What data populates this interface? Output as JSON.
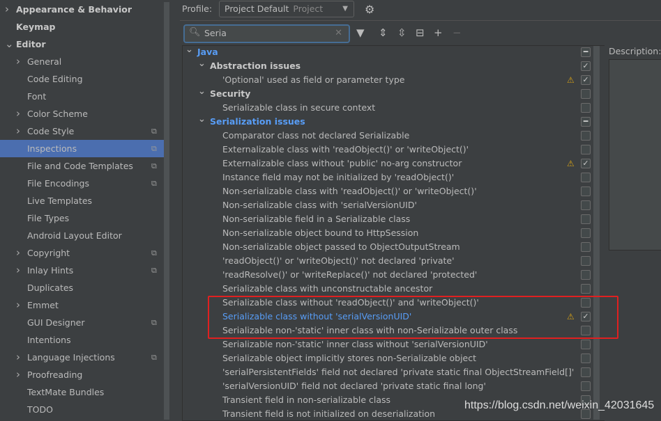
{
  "sidebar": {
    "items": [
      {
        "label": "Appearance & Behavior",
        "level": 0,
        "chevron": "right",
        "bold": true
      },
      {
        "label": "Keymap",
        "level": 0,
        "bold": true
      },
      {
        "label": "Editor",
        "level": 0,
        "chevron": "down",
        "bold": true
      },
      {
        "label": "General",
        "level": 1,
        "chevron": "right"
      },
      {
        "label": "Code Editing",
        "level": 1
      },
      {
        "label": "Font",
        "level": 1
      },
      {
        "label": "Color Scheme",
        "level": 1,
        "chevron": "right"
      },
      {
        "label": "Code Style",
        "level": 1,
        "chevron": "right",
        "copy": true
      },
      {
        "label": "Inspections",
        "level": 1,
        "copy": true,
        "selected": true
      },
      {
        "label": "File and Code Templates",
        "level": 1,
        "copy": true
      },
      {
        "label": "File Encodings",
        "level": 1,
        "copy": true
      },
      {
        "label": "Live Templates",
        "level": 1
      },
      {
        "label": "File Types",
        "level": 1
      },
      {
        "label": "Android Layout Editor",
        "level": 1
      },
      {
        "label": "Copyright",
        "level": 1,
        "chevron": "right",
        "copy": true
      },
      {
        "label": "Inlay Hints",
        "level": 1,
        "chevron": "right",
        "copy": true
      },
      {
        "label": "Duplicates",
        "level": 1
      },
      {
        "label": "Emmet",
        "level": 1,
        "chevron": "right"
      },
      {
        "label": "GUI Designer",
        "level": 1,
        "copy": true
      },
      {
        "label": "Intentions",
        "level": 1
      },
      {
        "label": "Language Injections",
        "level": 1,
        "chevron": "right",
        "copy": true
      },
      {
        "label": "Proofreading",
        "level": 1,
        "chevron": "right"
      },
      {
        "label": "TextMate Bundles",
        "level": 1
      },
      {
        "label": "TODO",
        "level": 1
      }
    ]
  },
  "profile": {
    "label": "Profile:",
    "value": "Project Default",
    "scope": "Project"
  },
  "search": {
    "value": "Seria"
  },
  "description": {
    "label": "Description:"
  },
  "tree": [
    {
      "label": "Java",
      "level": 0,
      "type": "java",
      "state": "partial"
    },
    {
      "label": "Abstraction issues",
      "level": 1,
      "type": "cat",
      "state": "checked"
    },
    {
      "label": "'Optional' used as field or parameter type",
      "level": 2,
      "state": "checked",
      "warning": true
    },
    {
      "label": "Security",
      "level": 1,
      "type": "cat",
      "state": "unchecked"
    },
    {
      "label": "Serializable class in secure context",
      "level": 2,
      "state": "unchecked"
    },
    {
      "label": "Serialization issues",
      "level": 1,
      "type": "java",
      "state": "partial"
    },
    {
      "label": "Comparator class not declared Serializable",
      "level": 2,
      "state": "unchecked"
    },
    {
      "label": "Externalizable class with 'readObject()' or 'writeObject()'",
      "level": 2,
      "state": "unchecked"
    },
    {
      "label": "Externalizable class without 'public' no-arg constructor",
      "level": 2,
      "state": "checked",
      "warning": true
    },
    {
      "label": "Instance field may not be initialized by 'readObject()'",
      "level": 2,
      "state": "unchecked"
    },
    {
      "label": "Non-serializable class with 'readObject()' or 'writeObject()'",
      "level": 2,
      "state": "unchecked"
    },
    {
      "label": "Non-serializable class with 'serialVersionUID'",
      "level": 2,
      "state": "unchecked"
    },
    {
      "label": "Non-serializable field in a Serializable class",
      "level": 2,
      "state": "unchecked"
    },
    {
      "label": "Non-serializable object bound to HttpSession",
      "level": 2,
      "state": "unchecked"
    },
    {
      "label": "Non-serializable object passed to ObjectOutputStream",
      "level": 2,
      "state": "unchecked"
    },
    {
      "label": "'readObject()' or 'writeObject()' not declared 'private'",
      "level": 2,
      "state": "unchecked"
    },
    {
      "label": "'readResolve()' or 'writeReplace()' not declared 'protected'",
      "level": 2,
      "state": "unchecked"
    },
    {
      "label": "Serializable class with unconstructable ancestor",
      "level": 2,
      "state": "unchecked"
    },
    {
      "label": "Serializable class without 'readObject()' and 'writeObject()'",
      "level": 2,
      "state": "unchecked"
    },
    {
      "label": "Serializable class without 'serialVersionUID'",
      "level": 2,
      "state": "checked",
      "warning": true,
      "highlight": true
    },
    {
      "label": "Serializable non-'static' inner class with non-Serializable outer class",
      "level": 2,
      "state": "unchecked"
    },
    {
      "label": "Serializable non-'static' inner class without 'serialVersionUID'",
      "level": 2,
      "state": "unchecked"
    },
    {
      "label": "Serializable object implicitly stores non-Serializable object",
      "level": 2,
      "state": "unchecked"
    },
    {
      "label": "'serialPersistentFields' field not declared 'private static final ObjectStreamField[]'",
      "level": 2,
      "state": "unchecked"
    },
    {
      "label": "'serialVersionUID' field not declared 'private static final long'",
      "level": 2,
      "state": "unchecked"
    },
    {
      "label": "Transient field in non-serializable class",
      "level": 2,
      "state": "unchecked"
    },
    {
      "label": "Transient field is not initialized on deserialization",
      "level": 2,
      "state": "unchecked"
    }
  ],
  "watermark": "https://blog.csdn.net/weixin_42031645",
  "colors": {
    "selection": "#4b6eaf",
    "link": "#589df6",
    "warning": "#d4a017",
    "annotation": "#e02020"
  }
}
